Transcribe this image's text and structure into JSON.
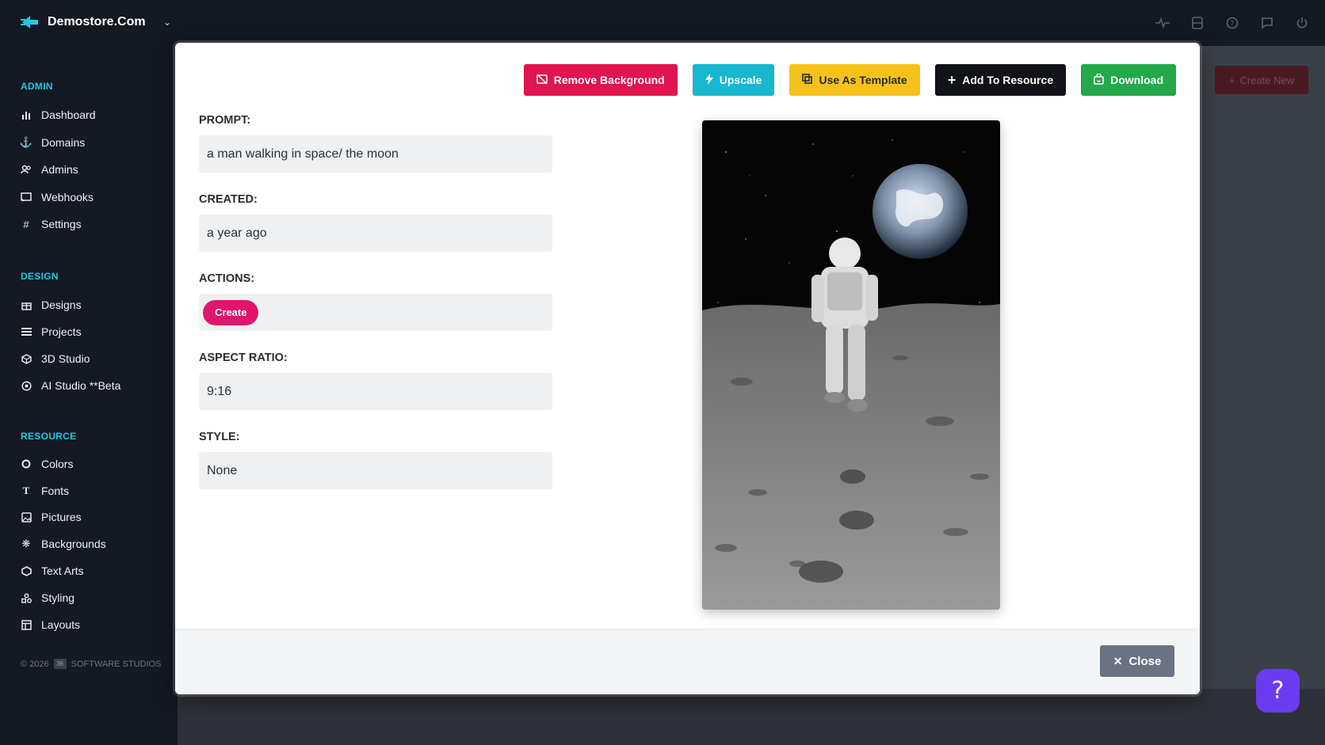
{
  "brand": {
    "name": "Demostore.Com"
  },
  "sidebar": {
    "sections": [
      {
        "title": "ADMIN",
        "items": [
          {
            "label": "Dashboard",
            "icon": "bar-chart-icon"
          },
          {
            "label": "Domains",
            "icon": "anchor-icon"
          },
          {
            "label": "Admins",
            "icon": "users-icon"
          },
          {
            "label": "Webhooks",
            "icon": "cast-icon"
          },
          {
            "label": "Settings",
            "icon": "hash-icon"
          }
        ]
      },
      {
        "title": "DESIGN",
        "items": [
          {
            "label": "Designs",
            "icon": "gift-icon"
          },
          {
            "label": "Projects",
            "icon": "layers-icon"
          },
          {
            "label": "3D Studio",
            "icon": "cube-icon"
          },
          {
            "label": "AI Studio **Beta",
            "icon": "aperture-icon"
          }
        ]
      },
      {
        "title": "RESOURCE",
        "items": [
          {
            "label": "Colors",
            "icon": "circle-icon"
          },
          {
            "label": "Fonts",
            "icon": "type-icon"
          },
          {
            "label": "Pictures",
            "icon": "image-icon"
          },
          {
            "label": "Backgrounds",
            "icon": "pattern-icon"
          },
          {
            "label": "Text Arts",
            "icon": "box-icon"
          },
          {
            "label": "Styling",
            "icon": "shapes-icon"
          },
          {
            "label": "Layouts",
            "icon": "layout-icon"
          }
        ]
      }
    ],
    "footer": {
      "copy": "© 2026",
      "logo": "36",
      "company": "SOFTWARE STUDIOS"
    }
  },
  "topbar": {
    "create_new": "Create New"
  },
  "modal": {
    "toolbar": {
      "remove_background": "Remove Background",
      "upscale": "Upscale",
      "use_as_template": "Use As Template",
      "add_to_resource": "Add To Resource",
      "download": "Download"
    },
    "fields": {
      "prompt_label": "PROMPT:",
      "prompt_value": "a man walking in space/ the moon",
      "created_label": "CREATED:",
      "created_value": "a year ago",
      "actions_label": "ACTIONS:",
      "actions_create": "Create",
      "aspect_label": "ASPECT RATIO:",
      "aspect_value": "9:16",
      "style_label": "STYLE:",
      "style_value": "None"
    },
    "close_label": "Close"
  },
  "help": {
    "label": "?"
  },
  "colors": {
    "accent_pink": "#e0144f",
    "accent_cyan": "#17b7cf",
    "accent_yellow": "#f6c21a",
    "accent_green": "#23a84a",
    "help_purple": "#6a3cf0"
  }
}
